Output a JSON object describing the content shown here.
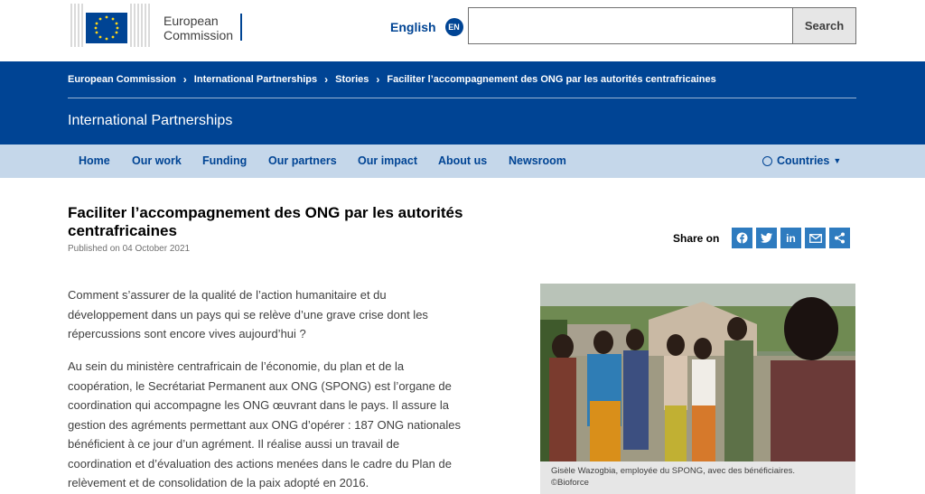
{
  "header": {
    "logo_line1": "European",
    "logo_line2": "Commission",
    "language_label": "English",
    "language_code": "EN",
    "search_placeholder": "",
    "search_button": "Search"
  },
  "breadcrumb": [
    "European Commission",
    "International Partnerships",
    "Stories",
    "Faciliter l’accompagnement des ONG par les autorités centrafricaines"
  ],
  "site_name": "International Partnerships",
  "nav": {
    "items": [
      "Home",
      "Our work",
      "Funding",
      "Our partners",
      "Our impact",
      "About us",
      "Newsroom"
    ],
    "countries": "Countries"
  },
  "article": {
    "title": "Faciliter l’accompagnement des ONG par les autorités centrafricaines",
    "published": "Published on 04 October 2021",
    "share_label": "Share on",
    "share_icons": [
      "facebook-icon",
      "twitter-icon",
      "linkedin-icon",
      "email-icon",
      "share-icon"
    ],
    "paragraphs": [
      "Comment s’assurer de la qualité de l’action humanitaire et du développement dans un pays qui se relève d’une grave crise dont les répercussions sont encore vives aujourd’hui ?",
      "Au sein du ministère centrafricain de l’économie, du plan et de la coopération, le Secrétariat Permanent aux ONG (SPONG) est l’organe de coordination qui accompagne les ONG œuvrant dans le pays. Il assure la gestion des agréments permettant aux ONG d’opérer : 187 ONG nationales bénéficient à ce jour d’un agrément. Il réalise aussi un travail de coordination et d’évaluation des actions menées dans le cadre du Plan de relèvement et de consolidation de la paix adopté en 2016."
    ],
    "caption_line1": "Gisèle Wazogbia, employée du SPONG, avec des bénéficiaires.",
    "caption_line2": "©Bioforce"
  },
  "colors": {
    "primary": "#004494",
    "nav_bg": "#c5d7ea",
    "share": "#2e7bbf",
    "eu_yellow": "#ffd617"
  }
}
